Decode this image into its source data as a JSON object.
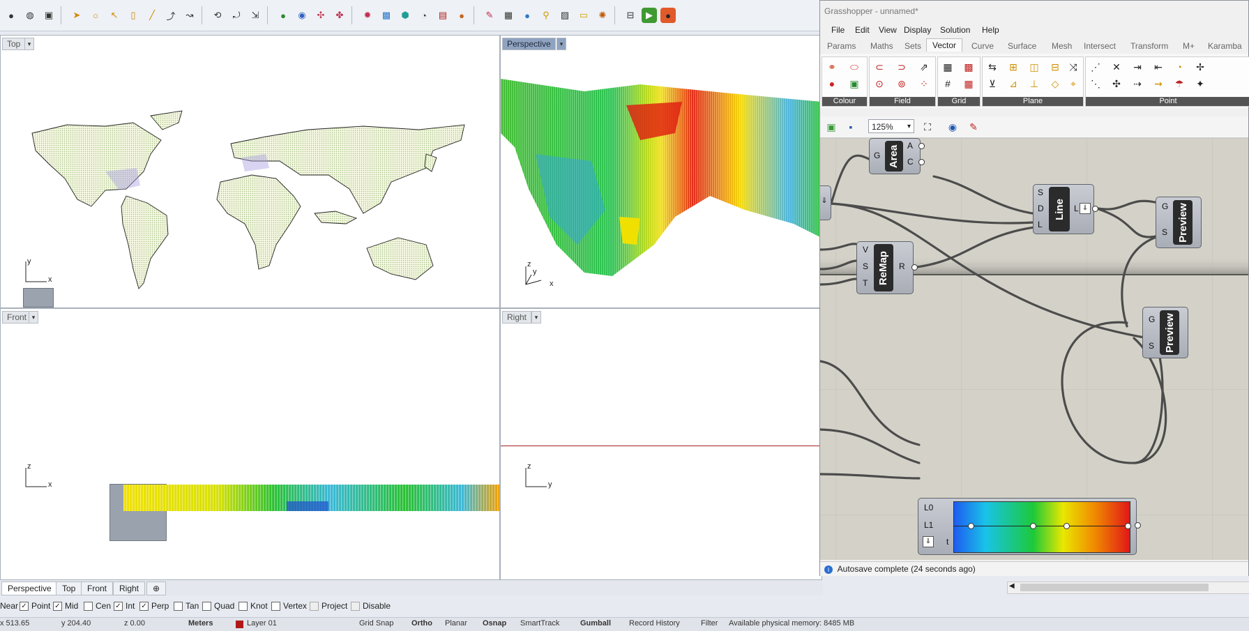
{
  "rhino": {
    "viewports": {
      "top": {
        "label": "Top",
        "axis_h": "x",
        "axis_v": "y"
      },
      "perspective": {
        "label": "Perspective",
        "axis_h": "x",
        "axis_v": "y",
        "axis_z": "z"
      },
      "front": {
        "label": "Front",
        "axis_h": "x",
        "axis_v": "z"
      },
      "right": {
        "label": "Right",
        "axis_h": "y",
        "axis_v": "z"
      }
    },
    "view_tabs": [
      "Perspective",
      "Top",
      "Front",
      "Right"
    ],
    "osnaps": [
      {
        "label": "Near",
        "checked": false
      },
      {
        "label": "Point",
        "checked": true
      },
      {
        "label": "Mid",
        "checked": true
      },
      {
        "label": "Cen",
        "checked": false
      },
      {
        "label": "Int",
        "checked": true
      },
      {
        "label": "Perp",
        "checked": true
      },
      {
        "label": "Tan",
        "checked": false
      },
      {
        "label": "Quad",
        "checked": false
      },
      {
        "label": "Knot",
        "checked": false
      },
      {
        "label": "Vertex",
        "checked": false
      },
      {
        "label": "Project",
        "checked": false,
        "disabled": true
      },
      {
        "label": "Disable",
        "checked": false,
        "disabled": true
      }
    ],
    "status": {
      "x": "x 513.65",
      "y": "y 204.40",
      "z": "z 0.00",
      "units": "Meters",
      "layer": "Layer 01",
      "grid_snap": "Grid Snap",
      "ortho": "Ortho",
      "planar": "Planar",
      "osnap": "Osnap",
      "smarttrack": "SmartTrack",
      "gumball": "Gumball",
      "record_history": "Record History",
      "filter": "Filter",
      "memory": "Available physical memory: 8485 MB"
    },
    "colors": {
      "layer_swatch": "#b01818",
      "accent": "#8fa3c1"
    }
  },
  "grasshopper": {
    "title": "Grasshopper - unnamed*",
    "menu": [
      "File",
      "Edit",
      "View",
      "Display",
      "Solution",
      "Help"
    ],
    "tabs": [
      "Params",
      "Maths",
      "Sets",
      "Vector",
      "Curve",
      "Surface",
      "Mesh",
      "Intersect",
      "Transform",
      "M+",
      "Karamba"
    ],
    "active_tab": "Vector",
    "ribbon_groups": [
      "Colour",
      "Field",
      "Grid",
      "Plane",
      "Point"
    ],
    "zoom": "125%",
    "components": {
      "area": {
        "name": "Area",
        "inputs": [
          "G"
        ],
        "outputs": [
          "A",
          "C"
        ]
      },
      "line": {
        "name": "Line",
        "inputs": [
          "S",
          "D",
          "L"
        ],
        "outputs": [
          "L"
        ]
      },
      "preview1": {
        "name": "Preview",
        "inputs": [
          "G",
          "S"
        ]
      },
      "remap": {
        "name": "ReMap",
        "inputs": [
          "V",
          "S",
          "T"
        ],
        "outputs": [
          "R"
        ]
      },
      "preview2": {
        "name": "Preview",
        "inputs": [
          "G",
          "S"
        ]
      },
      "gradient": {
        "inputs": [
          "L0",
          "L1",
          "t"
        ]
      }
    },
    "status": "Autosave complete (24 seconds ago)"
  }
}
